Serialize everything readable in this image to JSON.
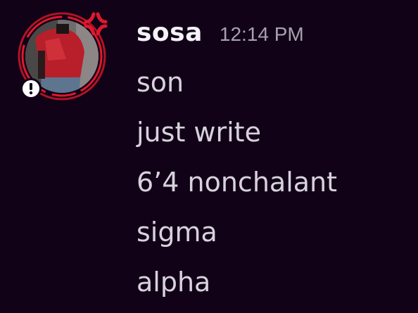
{
  "message": {
    "username": "sosa",
    "timestamp": "12:14 PM",
    "lines": [
      {
        "text": "son"
      },
      {
        "text": "just write"
      },
      {
        "text": "6’4 nonchalant"
      },
      {
        "text": "sigma"
      },
      {
        "text": "alpha"
      }
    ]
  },
  "avatar": {
    "icon": "user-avatar",
    "decoration": "anger-symbol-icon",
    "status_badge": "exclamation-badge-icon"
  },
  "colors": {
    "background": "#110218",
    "username": "#f5f2f7",
    "timestamp": "#a7a1ae",
    "message_text": "#d7d2dc",
    "accent_red": "#e0182d"
  }
}
